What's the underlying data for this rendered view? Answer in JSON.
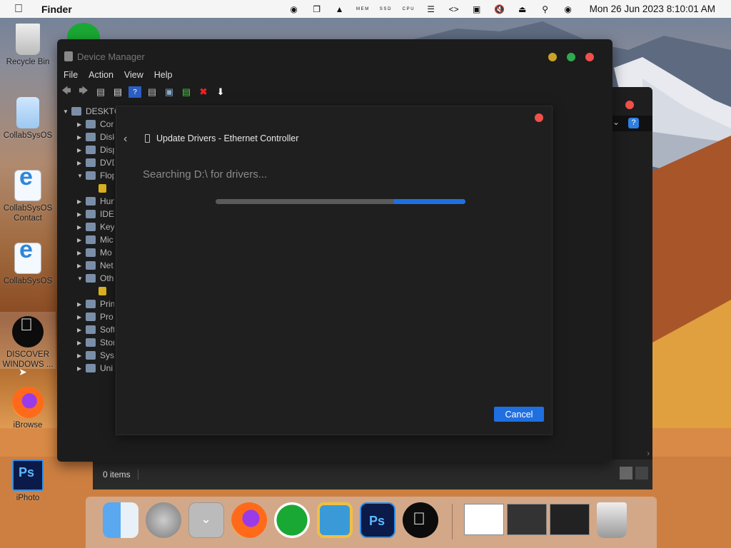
{
  "menubar": {
    "app_name": "Finder",
    "clock": "Mon 26 Jun 2023 8:10:01 AM",
    "tray_icons": [
      "github-icon",
      "copy-icon",
      "eject-icon",
      "mem-meter-icon",
      "ssd-meter-icon",
      "cpu-meter-icon",
      "list-icon",
      "code-icon",
      "monitor-icon",
      "mute-icon",
      "eject-icon",
      "search-icon",
      "control-center-icon"
    ],
    "tray_labels": {
      "mem": "M E M",
      "ssd": "S S D",
      "cpu": "C P U"
    }
  },
  "desktop_icons": [
    {
      "label": "Recycle Bin"
    },
    {
      "label": "CollabSysOS"
    },
    {
      "label": "CollabSysOS Contact"
    },
    {
      "label": "CollabSysOS"
    },
    {
      "label": "DISCOVER WINDOWS ..."
    },
    {
      "label": "iBrowse"
    },
    {
      "label": "iPhoto"
    }
  ],
  "background_window": {
    "status_text": "0 items"
  },
  "device_manager": {
    "title": "Device Manager",
    "menu": [
      "File",
      "Action",
      "View",
      "Help"
    ],
    "tree_root": "DESKTC",
    "tree_items": [
      {
        "label": "Cor",
        "expanded": false
      },
      {
        "label": "Disk",
        "expanded": false
      },
      {
        "label": "Disp",
        "expanded": false
      },
      {
        "label": "DVD",
        "expanded": false
      },
      {
        "label": "Flop",
        "expanded": true
      },
      {
        "label": "",
        "expanded": false,
        "child": true
      },
      {
        "label": "Hun",
        "expanded": false
      },
      {
        "label": "IDE",
        "expanded": false
      },
      {
        "label": "Key",
        "expanded": false
      },
      {
        "label": "Mic",
        "expanded": false
      },
      {
        "label": "Mo",
        "expanded": false
      },
      {
        "label": "Net",
        "expanded": false
      },
      {
        "label": "Oth",
        "expanded": true
      },
      {
        "label": "",
        "expanded": false,
        "child": true
      },
      {
        "label": "Prin",
        "expanded": false
      },
      {
        "label": "Pro",
        "expanded": false
      },
      {
        "label": "Soft",
        "expanded": false
      },
      {
        "label": "Stor",
        "expanded": false
      },
      {
        "label": "Syst",
        "expanded": false
      },
      {
        "label": "Uni",
        "expanded": false
      }
    ]
  },
  "dialog": {
    "title": "Update Drivers - Ethernet Controller",
    "status": "Searching D:\\ for drivers...",
    "cancel_label": "Cancel",
    "progress_start": 0.71,
    "progress_end": 1.0
  },
  "dock": {
    "apps": [
      "finder-icon",
      "launchpad-icon",
      "downloads-icon",
      "firefox-icon",
      "utorrent-icon",
      "file-manager-icon",
      "photoshop-icon",
      "apple-icon"
    ],
    "thumbnails": 3
  },
  "colors": {
    "accent": "#1f6fe0",
    "close": "#f0504a",
    "minimize": "#c9a227",
    "zoom": "#2fa84f"
  }
}
